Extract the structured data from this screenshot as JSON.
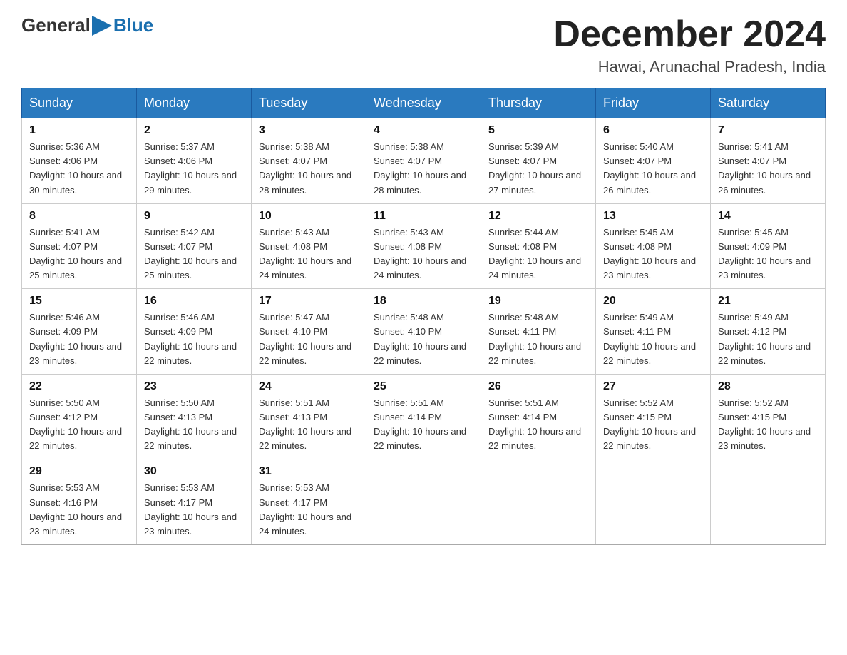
{
  "logo": {
    "general": "General",
    "blue": "Blue"
  },
  "header": {
    "month_year": "December 2024",
    "location": "Hawai, Arunachal Pradesh, India"
  },
  "weekdays": [
    "Sunday",
    "Monday",
    "Tuesday",
    "Wednesday",
    "Thursday",
    "Friday",
    "Saturday"
  ],
  "weeks": [
    [
      {
        "day": "1",
        "sunrise": "5:36 AM",
        "sunset": "4:06 PM",
        "daylight": "10 hours and 30 minutes."
      },
      {
        "day": "2",
        "sunrise": "5:37 AM",
        "sunset": "4:06 PM",
        "daylight": "10 hours and 29 minutes."
      },
      {
        "day": "3",
        "sunrise": "5:38 AM",
        "sunset": "4:07 PM",
        "daylight": "10 hours and 28 minutes."
      },
      {
        "day": "4",
        "sunrise": "5:38 AM",
        "sunset": "4:07 PM",
        "daylight": "10 hours and 28 minutes."
      },
      {
        "day": "5",
        "sunrise": "5:39 AM",
        "sunset": "4:07 PM",
        "daylight": "10 hours and 27 minutes."
      },
      {
        "day": "6",
        "sunrise": "5:40 AM",
        "sunset": "4:07 PM",
        "daylight": "10 hours and 26 minutes."
      },
      {
        "day": "7",
        "sunrise": "5:41 AM",
        "sunset": "4:07 PM",
        "daylight": "10 hours and 26 minutes."
      }
    ],
    [
      {
        "day": "8",
        "sunrise": "5:41 AM",
        "sunset": "4:07 PM",
        "daylight": "10 hours and 25 minutes."
      },
      {
        "day": "9",
        "sunrise": "5:42 AM",
        "sunset": "4:07 PM",
        "daylight": "10 hours and 25 minutes."
      },
      {
        "day": "10",
        "sunrise": "5:43 AM",
        "sunset": "4:08 PM",
        "daylight": "10 hours and 24 minutes."
      },
      {
        "day": "11",
        "sunrise": "5:43 AM",
        "sunset": "4:08 PM",
        "daylight": "10 hours and 24 minutes."
      },
      {
        "day": "12",
        "sunrise": "5:44 AM",
        "sunset": "4:08 PM",
        "daylight": "10 hours and 24 minutes."
      },
      {
        "day": "13",
        "sunrise": "5:45 AM",
        "sunset": "4:08 PM",
        "daylight": "10 hours and 23 minutes."
      },
      {
        "day": "14",
        "sunrise": "5:45 AM",
        "sunset": "4:09 PM",
        "daylight": "10 hours and 23 minutes."
      }
    ],
    [
      {
        "day": "15",
        "sunrise": "5:46 AM",
        "sunset": "4:09 PM",
        "daylight": "10 hours and 23 minutes."
      },
      {
        "day": "16",
        "sunrise": "5:46 AM",
        "sunset": "4:09 PM",
        "daylight": "10 hours and 22 minutes."
      },
      {
        "day": "17",
        "sunrise": "5:47 AM",
        "sunset": "4:10 PM",
        "daylight": "10 hours and 22 minutes."
      },
      {
        "day": "18",
        "sunrise": "5:48 AM",
        "sunset": "4:10 PM",
        "daylight": "10 hours and 22 minutes."
      },
      {
        "day": "19",
        "sunrise": "5:48 AM",
        "sunset": "4:11 PM",
        "daylight": "10 hours and 22 minutes."
      },
      {
        "day": "20",
        "sunrise": "5:49 AM",
        "sunset": "4:11 PM",
        "daylight": "10 hours and 22 minutes."
      },
      {
        "day": "21",
        "sunrise": "5:49 AM",
        "sunset": "4:12 PM",
        "daylight": "10 hours and 22 minutes."
      }
    ],
    [
      {
        "day": "22",
        "sunrise": "5:50 AM",
        "sunset": "4:12 PM",
        "daylight": "10 hours and 22 minutes."
      },
      {
        "day": "23",
        "sunrise": "5:50 AM",
        "sunset": "4:13 PM",
        "daylight": "10 hours and 22 minutes."
      },
      {
        "day": "24",
        "sunrise": "5:51 AM",
        "sunset": "4:13 PM",
        "daylight": "10 hours and 22 minutes."
      },
      {
        "day": "25",
        "sunrise": "5:51 AM",
        "sunset": "4:14 PM",
        "daylight": "10 hours and 22 minutes."
      },
      {
        "day": "26",
        "sunrise": "5:51 AM",
        "sunset": "4:14 PM",
        "daylight": "10 hours and 22 minutes."
      },
      {
        "day": "27",
        "sunrise": "5:52 AM",
        "sunset": "4:15 PM",
        "daylight": "10 hours and 22 minutes."
      },
      {
        "day": "28",
        "sunrise": "5:52 AM",
        "sunset": "4:15 PM",
        "daylight": "10 hours and 23 minutes."
      }
    ],
    [
      {
        "day": "29",
        "sunrise": "5:53 AM",
        "sunset": "4:16 PM",
        "daylight": "10 hours and 23 minutes."
      },
      {
        "day": "30",
        "sunrise": "5:53 AM",
        "sunset": "4:17 PM",
        "daylight": "10 hours and 23 minutes."
      },
      {
        "day": "31",
        "sunrise": "5:53 AM",
        "sunset": "4:17 PM",
        "daylight": "10 hours and 24 minutes."
      },
      null,
      null,
      null,
      null
    ]
  ]
}
